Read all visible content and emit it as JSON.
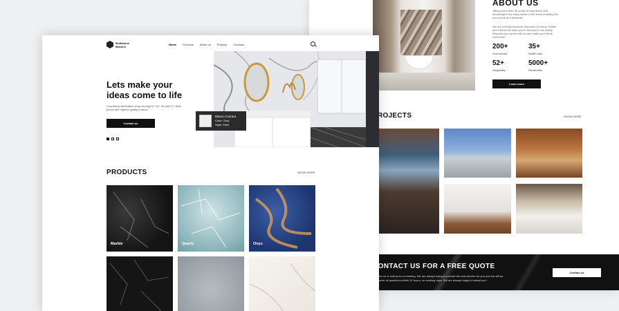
{
  "back": {
    "about": {
      "title": "ABOUT US",
      "p1": "Taking more than 38 years of experience and knowledge from many areas of the stone industry into your home and business.",
      "p2": "We are a family business, founded by Lenny, Rafael and Gabriel we want you to feel part of our family. Request your quote with us and make your ideas come true!",
      "stats": [
        {
          "num": "200+",
          "label": "Commercial"
        },
        {
          "num": "35+",
          "label": "Health care"
        },
        {
          "num": "52+",
          "label": "Hospitality"
        },
        {
          "num": "5000+",
          "label": "Residential"
        }
      ],
      "button": "Learn more"
    },
    "projects": {
      "title": "PROJECTS",
      "more": "SHOW MORE"
    },
    "cta": {
      "title": "CONTACT US FOR A FREE QUOTE",
      "text": "Contact us or visit us for a meeting. We are always trying to provide the best service for you and we will try to answer all questions within 24 hours, on working days. We are always happy to assist you!",
      "button": "Contact us"
    }
  },
  "front": {
    "logo": {
      "line1": "Multistone",
      "line2": "Masters"
    },
    "nav": [
      "Home",
      "Products",
      "About us",
      "Projects",
      "Contacts"
    ],
    "hero": {
      "title": "Lets make your ideas come to life",
      "text": "Countertop fabrication shop serving NJ, NY, PA and CT. Best prices and highest quality product.",
      "button": "Contact us"
    },
    "info": {
      "name": "Bianco Carrara",
      "color": "Color: Grey",
      "style": "Style: Plain"
    },
    "products": {
      "title": "PRODUCTS",
      "more": "SHOW MORE",
      "items": [
        "Marble",
        "Quartz",
        "Onyx"
      ]
    }
  },
  "colors": {
    "accent": "#111111",
    "background": "#eef0f2",
    "card": "#ffffff"
  }
}
